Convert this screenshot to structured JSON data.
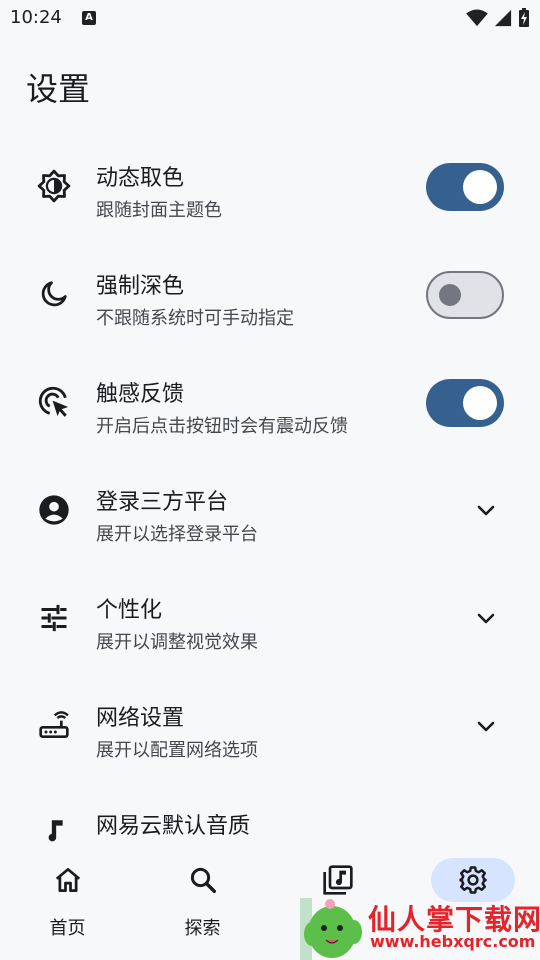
{
  "status_bar": {
    "time": "10:24",
    "app_badge": "A"
  },
  "page": {
    "title": "设置"
  },
  "settings": [
    {
      "title": "动态取色",
      "subtitle": "跟随封面主题色",
      "control": "toggle",
      "checked": true,
      "icon": "brightness-auto-icon"
    },
    {
      "title": "强制深色",
      "subtitle": "不跟随系统时可手动指定",
      "control": "toggle",
      "checked": false,
      "icon": "moon-icon"
    },
    {
      "title": "触感反馈",
      "subtitle": "开启后点击按钮时会有震动反馈",
      "control": "toggle",
      "checked": true,
      "icon": "touch-click-icon"
    },
    {
      "title": "登录三方平台",
      "subtitle": "展开以选择登录平台",
      "control": "expand",
      "icon": "account-circle-icon"
    },
    {
      "title": "个性化",
      "subtitle": "展开以调整视觉效果",
      "control": "expand",
      "icon": "tune-icon"
    },
    {
      "title": "网络设置",
      "subtitle": "展开以配置网络选项",
      "control": "expand",
      "icon": "router-icon"
    },
    {
      "title": "网易云默认音质",
      "subtitle": "",
      "control": "none",
      "icon": "music-note-icon"
    }
  ],
  "nav": [
    {
      "label": "首页",
      "icon": "home-icon",
      "active": false
    },
    {
      "label": "探索",
      "icon": "search-icon",
      "active": false
    },
    {
      "label": "",
      "icon": "library-music-icon",
      "active": false
    },
    {
      "label": "",
      "icon": "gear-icon",
      "active": true
    }
  ],
  "watermark": {
    "text": "仙人掌下载网",
    "url": "www.hebxqrc.com"
  },
  "colors": {
    "accent": "#36608f",
    "background": "#f7f8fa",
    "active_nav": "#d6e4ff",
    "watermark": "#e4232b"
  }
}
